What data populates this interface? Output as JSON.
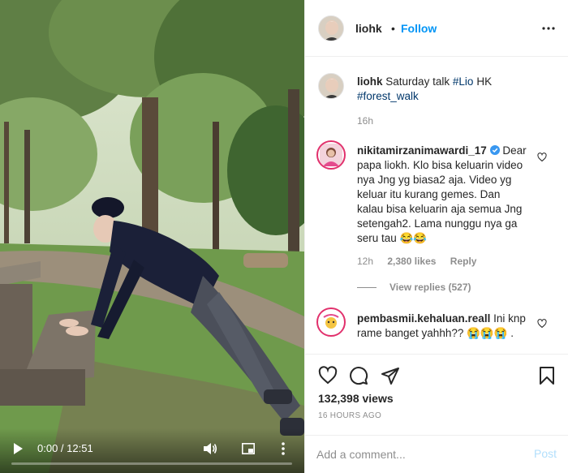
{
  "video": {
    "time_display": "0:00 / 12:51",
    "progress": 0.0
  },
  "header": {
    "username": "liohk",
    "separator": "•",
    "follow_label": "Follow"
  },
  "caption": {
    "username": "liohk",
    "text_before": "Saturday talk",
    "hashtag1": "#Lio",
    "text_mid": "HK",
    "hashtag2": "#forest_walk",
    "age": "16h"
  },
  "comments": [
    {
      "username": "nikitamirzanimawardi_17",
      "verified": true,
      "text": "Dear papa liokh. Klo bisa keluarin video nya Jng yg biasa2 aja. Video yg keluar itu kurang gemes. Dan kalau bisa keluarin aja semua Jng setengah2. Lama nunggu nya ga seru tau 😂😂",
      "age": "12h",
      "likes": "2,380 likes",
      "reply_label": "Reply",
      "view_replies": "View replies (527)"
    },
    {
      "username": "pembasmii.kehaluan.reall",
      "text": "Ini knp rame banget yahhh?? 😭😭😭 ."
    }
  ],
  "stats": {
    "views": "132,398 views",
    "time_ago": "16 HOURS AGO"
  },
  "add_comment": {
    "placeholder": "Add a comment...",
    "post_label": "Post"
  },
  "colors": {
    "accent": "#0095f6",
    "post_disabled": "#b2dffc",
    "hashtag": "#00376b",
    "muted": "#8e8e8e",
    "verified": "#3897f0"
  }
}
